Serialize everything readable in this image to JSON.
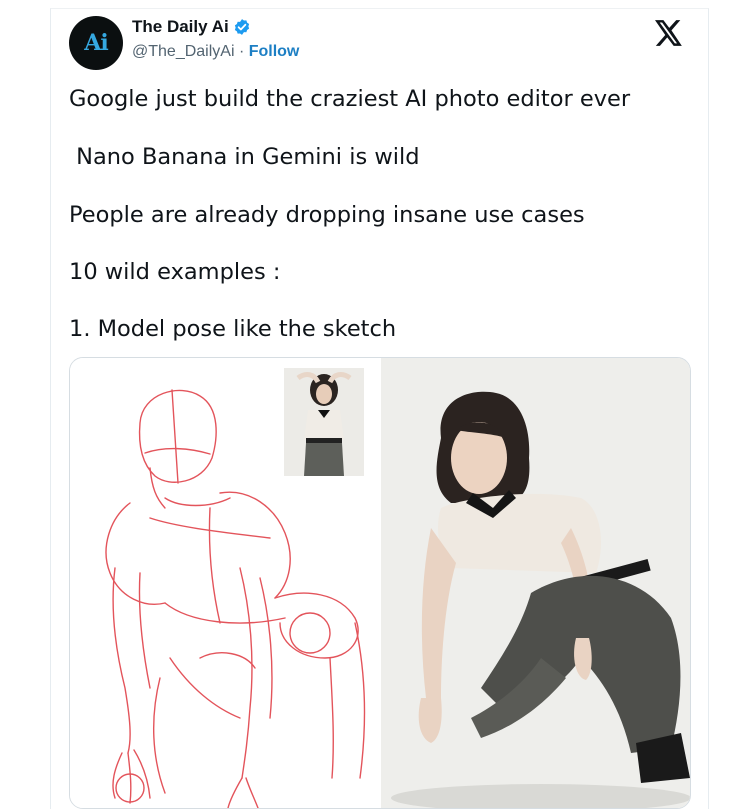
{
  "tweet": {
    "author_name": "The Daily Ai",
    "handle": "@The_DailyAi",
    "separator": " · ",
    "follow_label": "Follow",
    "avatar_text": "Ai",
    "lines": [
      "Google just build the craziest AI photo editor ever",
      " Nano Banana in Gemini is wild",
      "People are already dropping insane use cases",
      "10 wild examples :",
      "1. Model pose like the sketch"
    ]
  },
  "icons": {
    "verified": "verified-badge-icon",
    "x_logo": "x-logo-icon"
  },
  "colors": {
    "accent": "#1d9bf0",
    "follow_link": "#1d7fc4",
    "avatar_bg": "#0b0f10",
    "avatar_text": "#35a8e0",
    "sketch_line": "#e0424a"
  }
}
